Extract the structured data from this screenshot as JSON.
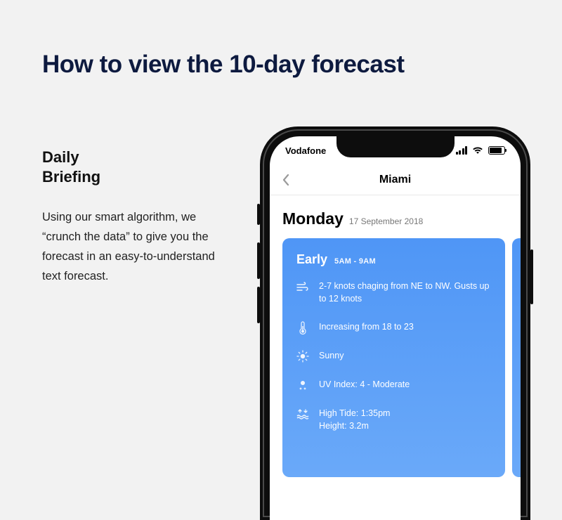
{
  "page": {
    "title": "How to view the 10-day forecast"
  },
  "sidebar": {
    "heading_line1": "Daily",
    "heading_line2": "Briefing",
    "body": "Using our smart algorithm, we “crunch the data” to give you the forecast in an easy-to-understand text forecast."
  },
  "status": {
    "carrier": "Vodafone"
  },
  "nav": {
    "title": "Miami"
  },
  "forecast": {
    "day_name": "Monday",
    "day_date": "17 September 2018",
    "card": {
      "period": "Early",
      "period_time": "5AM - 9AM",
      "wind": "2-7 knots chaging from NE to NW. Gusts up to 12 knots",
      "temp": "Increasing from 18 to 23",
      "sky": "Sunny",
      "uv": "UV Index: 4 - Moderate",
      "tide": "High Tide: 1:35pm\nHeight: 3.2m"
    }
  }
}
